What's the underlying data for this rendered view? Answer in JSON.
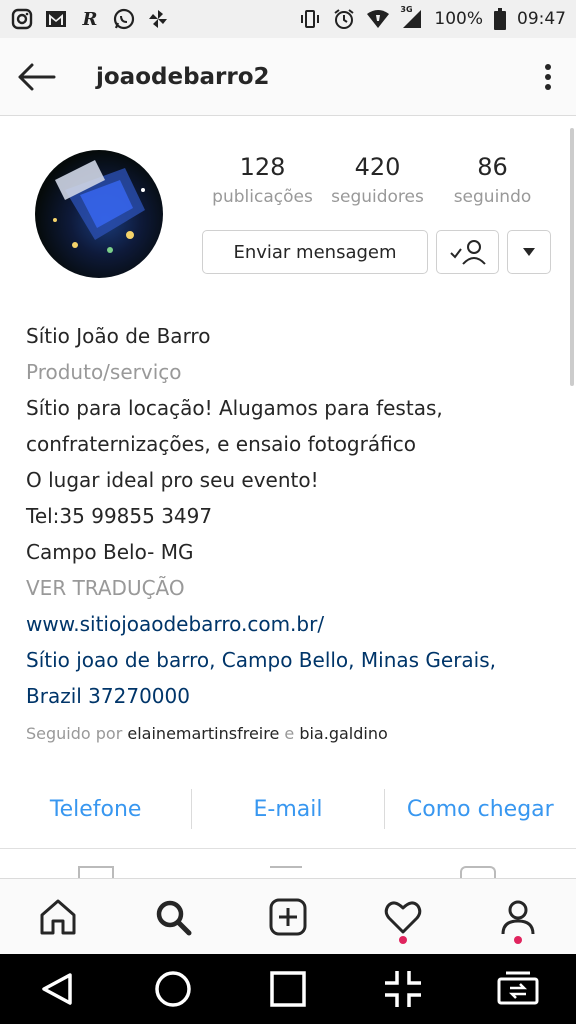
{
  "status_bar": {
    "battery": "100%",
    "time": "09:47",
    "network": "3G",
    "left_icons": [
      "instagram-icon",
      "gmail-icon",
      "r-app-icon",
      "whatsapp-icon",
      "pinwheel-icon"
    ],
    "right_icons": [
      "vibrate-icon",
      "alarm-icon",
      "wifi-icon",
      "signal-icon",
      "battery-icon"
    ]
  },
  "app_bar": {
    "title": "joaodebarro2"
  },
  "profile": {
    "stats": [
      {
        "value": "128",
        "label": "publicações"
      },
      {
        "value": "420",
        "label": "seguidores"
      },
      {
        "value": "86",
        "label": "seguindo"
      }
    ],
    "message_button": "Enviar mensagem"
  },
  "bio": {
    "name": "Sítio João de Barro",
    "category": "Produto/serviço",
    "lines": [
      "Sítio para locação! Alugamos para festas,",
      "confraternizações, e ensaio fotográfico",
      "O lugar ideal pro seu evento!",
      "Tel:35 99855 3497",
      "Campo Belo- MG"
    ],
    "translate": "VER TRADUÇÃO",
    "website": "www.sitiojoaodebarro.com.br/",
    "address_line1": "Sítio joao de barro, Campo Bello, Minas Gerais,",
    "address_line2": "Brazil 37270000",
    "followed_prefix": "Seguido por",
    "followed_user1": "elainemartinsfreire",
    "followed_and": "e",
    "followed_user2": "bia.galdino"
  },
  "contacts": [
    "Telefone",
    "E-mail",
    "Como chegar"
  ],
  "colors": {
    "link_blue": "#3897f0",
    "dark_link": "#003569",
    "notification_dot": "#e0245e"
  }
}
